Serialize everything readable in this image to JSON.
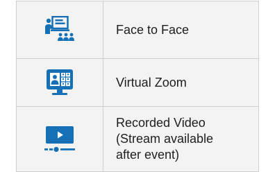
{
  "delivery_options": [
    {
      "label": "Face to Face",
      "icon": "presentation-classroom-icon"
    },
    {
      "label": "Virtual Zoom",
      "icon": "video-conference-monitor-icon"
    },
    {
      "label": "Recorded Video\n(Stream available\nafter event)",
      "icon": "video-player-icon"
    }
  ],
  "colors": {
    "icon_blue": "#1570b5",
    "border": "#cfcfcf",
    "background": "#f3f3f3",
    "text": "#1e1e1e"
  }
}
